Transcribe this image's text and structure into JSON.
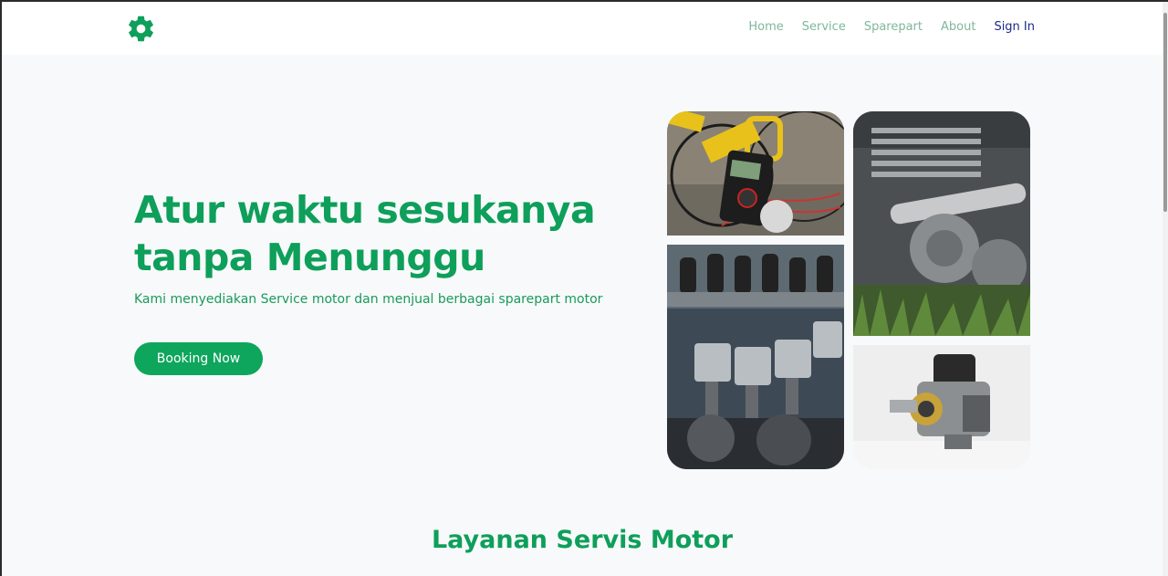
{
  "nav": {
    "logo_icon": "gear-icon",
    "links": [
      "Home",
      "Service",
      "Sparepart",
      "About"
    ],
    "signin": "Sign In"
  },
  "hero": {
    "title_line1": "Atur waktu sesukanya",
    "title_line2": "tanpa Menunggu",
    "subtitle": "Kami menyediakan Service motor dan menjual berbagai sparepart motor",
    "cta": "Booking Now"
  },
  "gallery": [
    {
      "icon": "multimeter-tools-photo"
    },
    {
      "icon": "engine-pistons-photo"
    },
    {
      "icon": "motorcycle-engine-photo"
    },
    {
      "icon": "carburetor-photo"
    }
  ],
  "section": {
    "title": "Layanan Servis Motor"
  },
  "colors": {
    "brand_green": "#0e9f5a",
    "nav_link": "#7fb79b",
    "signin": "#1c2a8a",
    "background": "#f7f9fa"
  }
}
